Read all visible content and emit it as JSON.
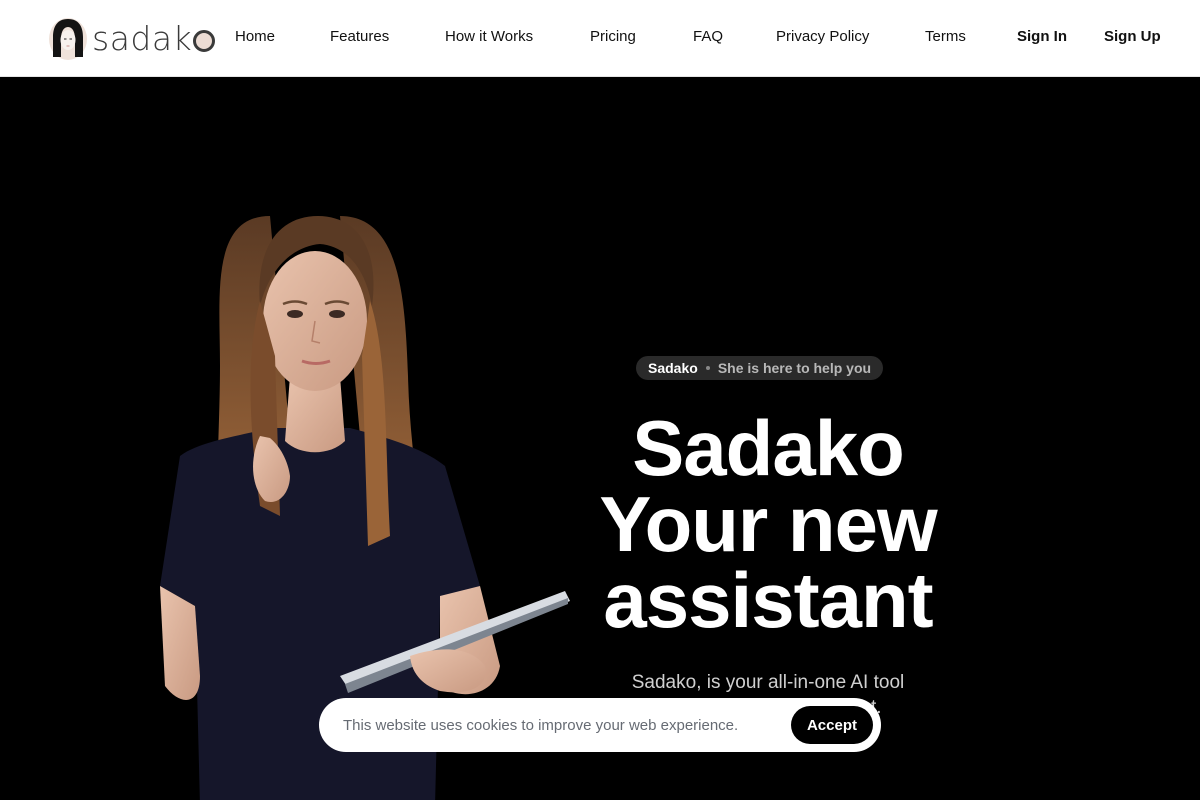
{
  "brand": {
    "name": "sadako",
    "logo_icon": "girl-portrait-icon"
  },
  "nav": {
    "links": [
      {
        "label": "Home"
      },
      {
        "label": "Features"
      },
      {
        "label": "How it Works"
      },
      {
        "label": "Pricing"
      },
      {
        "label": "FAQ"
      },
      {
        "label": "Privacy Policy"
      },
      {
        "label": "Terms"
      }
    ],
    "sign_in": "Sign In",
    "sign_up": "Sign Up"
  },
  "hero": {
    "badge": {
      "name": "Sadako",
      "separator_icon": "dot-icon",
      "text": "She is here to help you"
    },
    "headline": [
      "Sadako",
      "Your new",
      "assistant"
    ],
    "subtitle": [
      "Sadako, is your all-in-one AI tool",
      "assistant to create content."
    ],
    "image": "girl-holding-tablet-illustration"
  },
  "cookie_banner": {
    "message": "This website uses cookies to improve your web experience.",
    "accept_label": "Accept"
  },
  "colors": {
    "nav_bg": "#ffffff",
    "hero_bg": "#000000",
    "badge_bg": "#2a2a2a",
    "logo_accent": "#ecdcd4",
    "button_bg": "#000000"
  }
}
